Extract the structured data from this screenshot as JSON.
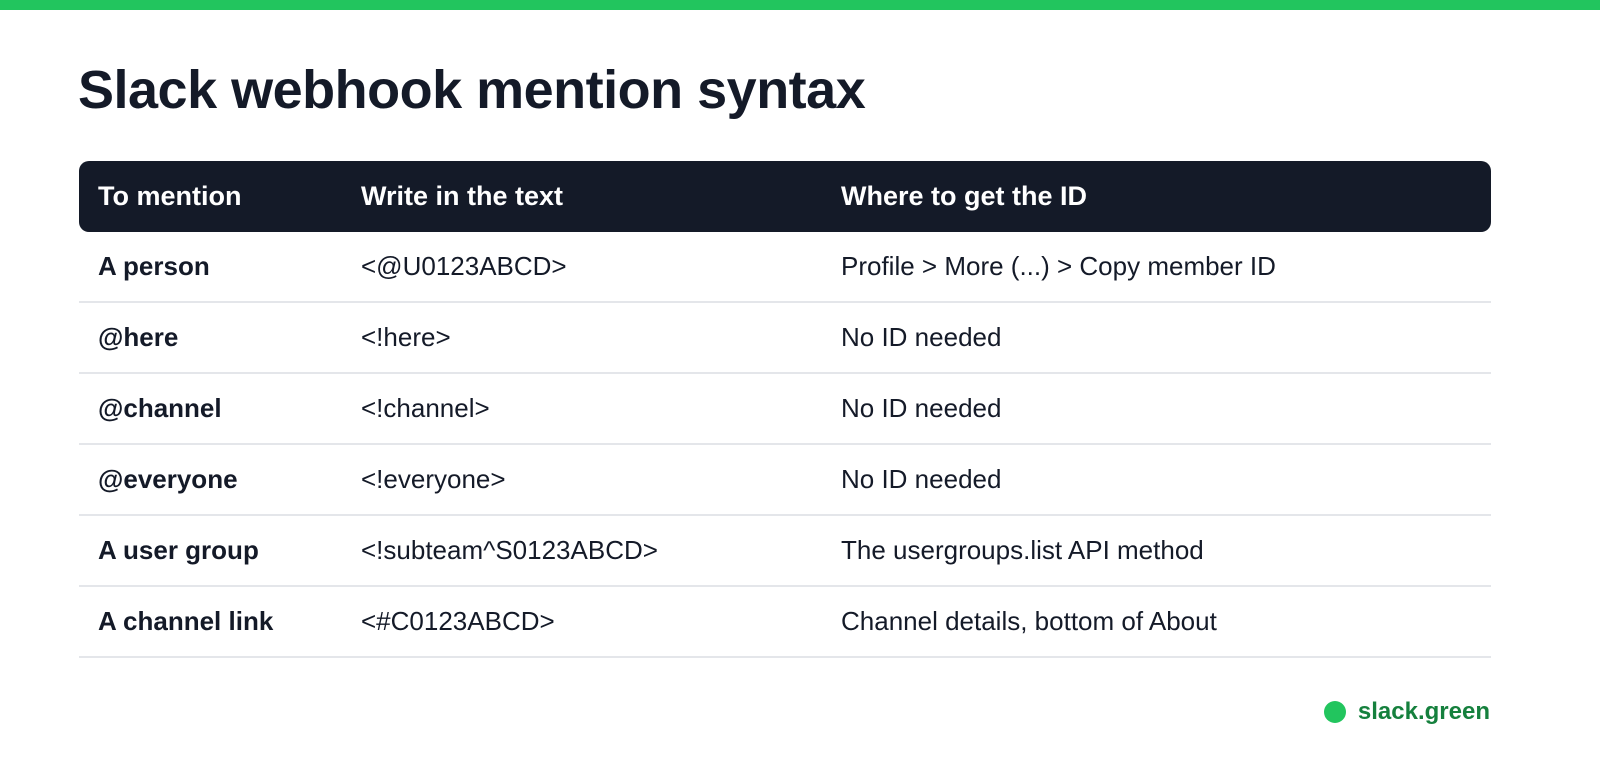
{
  "colors": {
    "accent": "#22c55e",
    "brand_text": "#15803d",
    "header_bg": "#141a28",
    "text": "#141a28",
    "divider": "#e4e6ea"
  },
  "page": {
    "title": "Slack webhook mention syntax"
  },
  "table": {
    "headers": [
      "To mention",
      "Write in the text",
      "Where to get the ID"
    ],
    "rows": [
      [
        "A person",
        "<@U0123ABCD>",
        "Profile > More (...) > Copy member ID"
      ],
      [
        "@here",
        "<!here>",
        "No ID needed"
      ],
      [
        "@channel",
        "<!channel>",
        "No ID needed"
      ],
      [
        "@everyone",
        "<!everyone>",
        "No ID needed"
      ],
      [
        "A user group",
        "<!subteam^S0123ABCD>",
        "The usergroups.list API method"
      ],
      [
        "A channel link",
        "<#C0123ABCD>",
        "Channel details, bottom of About"
      ]
    ]
  },
  "footer": {
    "brand_icon": "green-dot-icon",
    "brand_text": "slack.green"
  }
}
